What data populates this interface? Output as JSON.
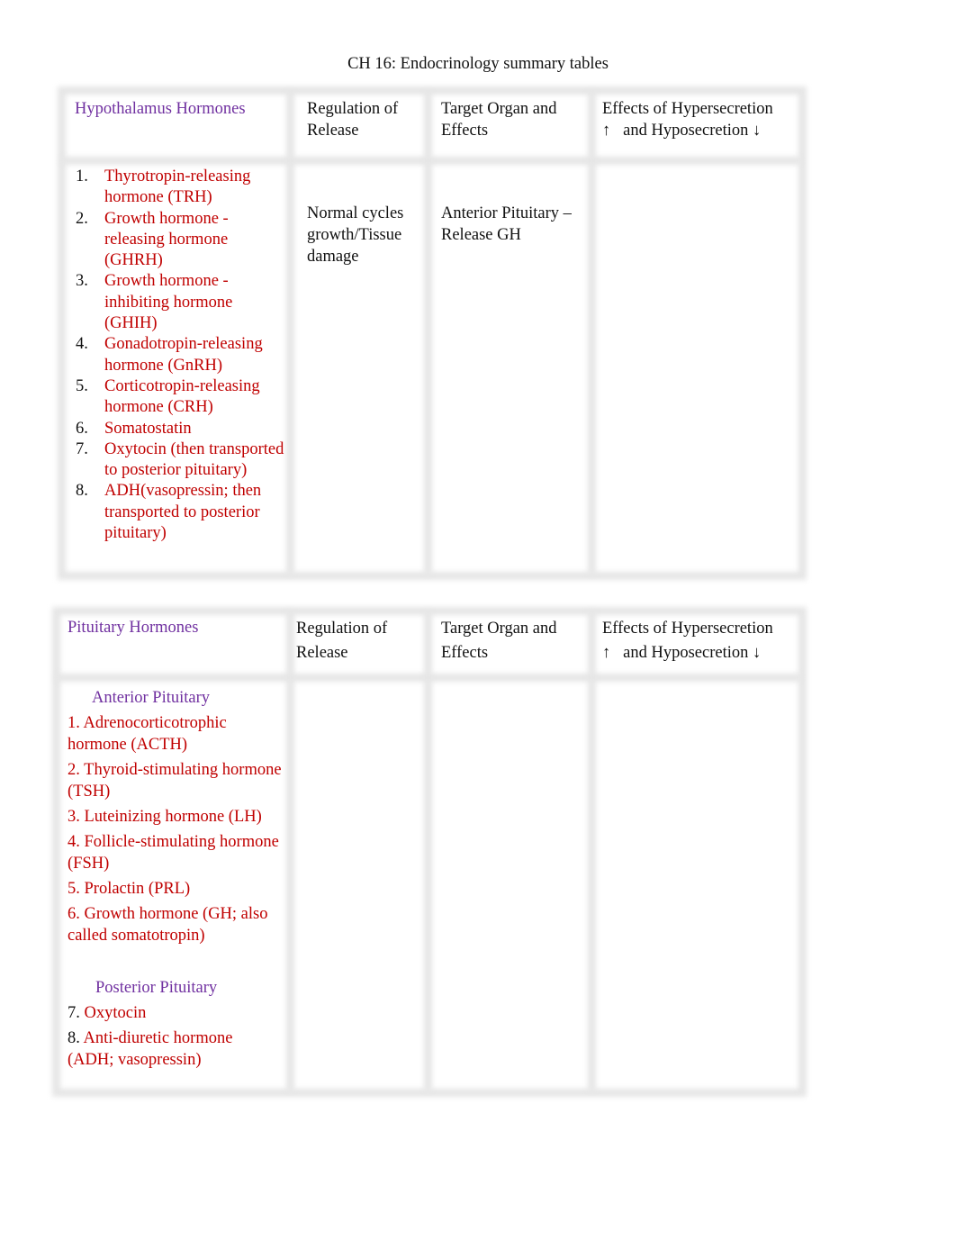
{
  "document": {
    "title": "CH 16: Endocrinology summary tables"
  },
  "table1": {
    "headers": {
      "col1": "Hypothalamus Hormones",
      "col2": "Regulation of Release",
      "col3": "Target Organ and Effects",
      "col4_line1": "Effects of Hypersecretion",
      "col4_line2": "↑   and Hyposecretion ↓"
    },
    "hormones": [
      {
        "num": "1.",
        "text": "Thyrotropin-releasing hormone  (TRH)"
      },
      {
        "num": "2.",
        "text": "Growth hormone - releasing hormone (GHRH)"
      },
      {
        "num": "3.",
        "text": "Growth hormone - inhibiting hormone (GHIH)"
      },
      {
        "num": "4.",
        "text": "Gonadotropin-releasing hormone  (GnRH)"
      },
      {
        "num": "5.",
        "text": "Corticotropin-releasing hormone  (CRH)"
      },
      {
        "num": "6.",
        "text": "Somatostatin"
      },
      {
        "num": "7.",
        "text": "Oxytocin (then transported to posterior pituitary)"
      },
      {
        "num": "8.",
        "text": "ADH(vasopressin; then transported to posterior pituitary)"
      }
    ],
    "regulation": "Normal cycles growth/Tissue damage",
    "target": "Anterior Pituitary – Release GH",
    "effects": ""
  },
  "table2": {
    "headers": {
      "col1": "Pituitary Hormones",
      "col2": "Regulation of Release",
      "col3": "Target Organ and Effects",
      "col4_line1": "Effects of Hypersecretion",
      "col4_line2": "↑   and Hyposecretion ↓"
    },
    "anterior_label": "Anterior Pituitary",
    "anterior": [
      "1. Adrenocorticotrophic hormone (ACTH)",
      "2. Thyroid-stimulating hormone (TSH)",
      "3. Luteinizing hormone (LH)",
      "4. Follicle-stimulating hormone (FSH)",
      "5. Prolactin (PRL)",
      "6. Growth hormone (GH; also called somatotropin)"
    ],
    "posterior_label": "Posterior Pituitary",
    "posterior": [
      {
        "num": "7.",
        "text": " Oxytocin"
      },
      {
        "num": "8.",
        "text": " Anti-diuretic hormone (ADH; vasopressin)"
      }
    ],
    "regulation": "",
    "target": "",
    "effects": ""
  }
}
